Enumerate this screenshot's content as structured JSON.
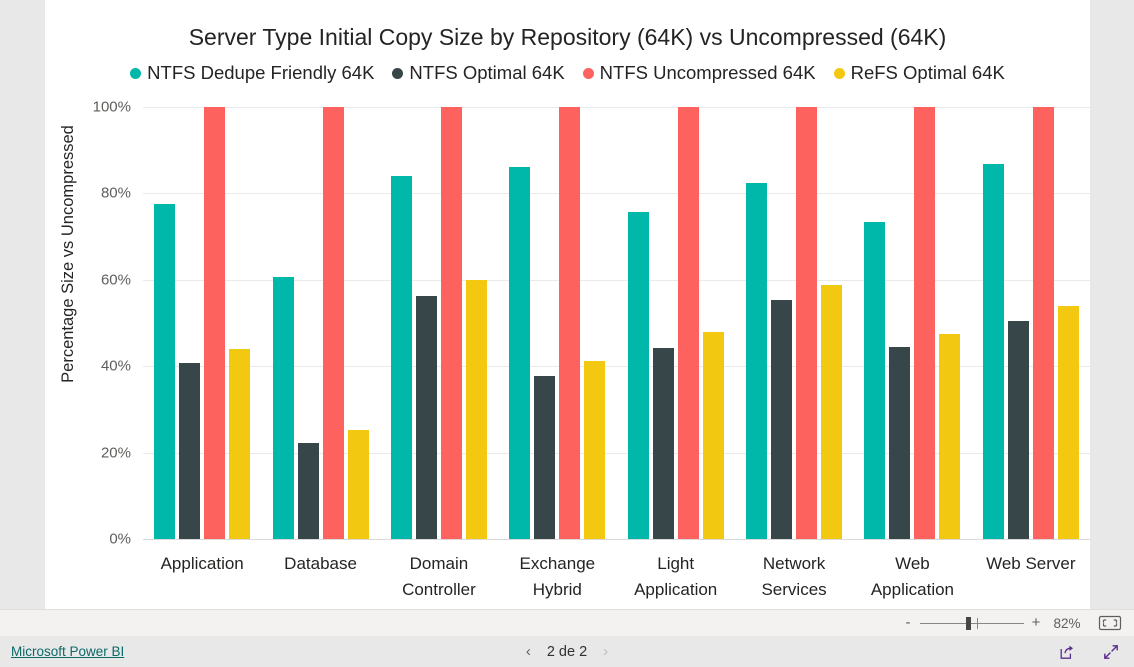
{
  "chart_data": {
    "type": "bar",
    "title": "Server Type Initial Copy Size by Repository (64K) vs Uncompressed (64K)",
    "xlabel": "",
    "ylabel": "Percentage Size vs Uncompressed",
    "ylim": [
      0,
      100
    ],
    "ytick_labels": [
      "100%",
      "80%",
      "60%",
      "40%",
      "20%",
      "0%"
    ],
    "ytick_values": [
      100,
      80,
      60,
      40,
      20,
      0
    ],
    "grid": true,
    "legend_position": "top",
    "categories": [
      "Application",
      "Database",
      "Domain Controller",
      "Exchange Hybrid",
      "Light Application",
      "Network Services",
      "Web Application",
      "Web Server"
    ],
    "series": [
      {
        "name": "NTFS Dedupe Friendly 64K",
        "color": "#00B8AA",
        "values": [
          77.4,
          60.6,
          83.9,
          85.9,
          75.5,
          82.3,
          73.2,
          86.8
        ]
      },
      {
        "name": "NTFS Optimal 64K",
        "color": "#374649",
        "values": [
          40.8,
          22.1,
          56.2,
          37.8,
          44.2,
          55.3,
          44.3,
          50.5
        ]
      },
      {
        "name": "NTFS Uncompressed 64K",
        "color": "#FD625E",
        "values": [
          100,
          100,
          100,
          100,
          100,
          100,
          100,
          100
        ]
      },
      {
        "name": "ReFS Optimal 64K",
        "color": "#F2C811",
        "values": [
          44.0,
          25.2,
          59.8,
          41.2,
          47.8,
          58.8,
          47.5,
          53.8
        ]
      }
    ]
  },
  "zoom_bar": {
    "minus_label": "-",
    "plus_label": "+",
    "zoom_value": "82%",
    "fit_icon": "fit-to-page-icon"
  },
  "footer": {
    "brand": "Microsoft Power BI",
    "prev_arrow": "‹",
    "next_arrow": "›",
    "page_label": "2 de 2",
    "share_icon": "share-icon",
    "fullscreen_icon": "fullscreen-icon"
  }
}
